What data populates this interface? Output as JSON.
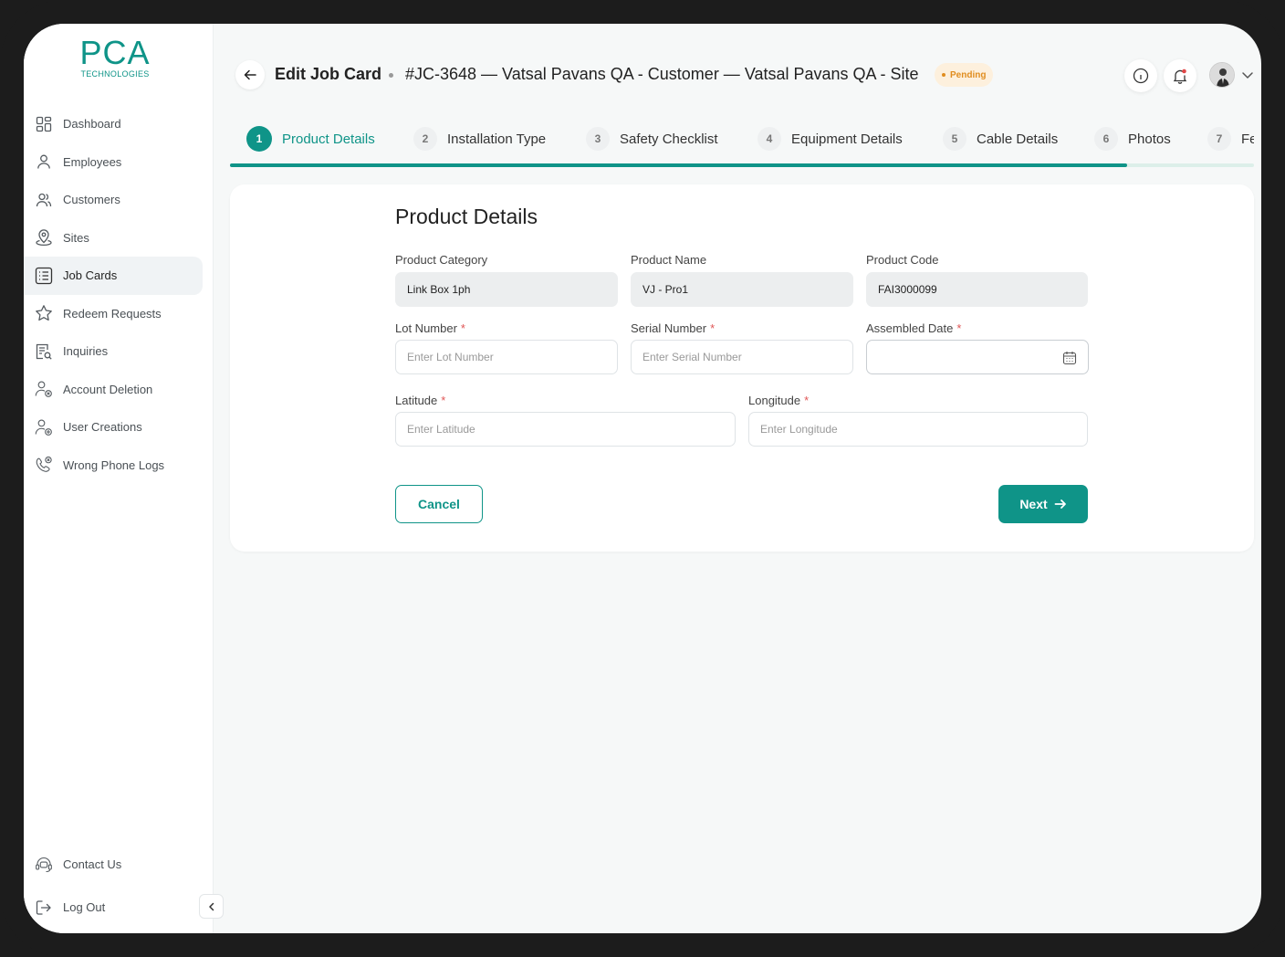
{
  "logo": {
    "main": "PCA",
    "sub": "TECHNOLOGIES"
  },
  "sidebar": {
    "items": [
      {
        "label": "Dashboard",
        "icon": "dashboard-grid-icon",
        "active": false
      },
      {
        "label": "Employees",
        "icon": "user-icon",
        "active": false
      },
      {
        "label": "Customers",
        "icon": "users-icon",
        "active": false
      },
      {
        "label": "Sites",
        "icon": "location-pin-icon",
        "active": false
      },
      {
        "label": "Job Cards",
        "icon": "list-icon",
        "active": true
      },
      {
        "label": "Redeem Requests",
        "icon": "star-icon",
        "active": false
      },
      {
        "label": "Inquiries",
        "icon": "document-search-icon",
        "active": false
      },
      {
        "label": "Account Deletion",
        "icon": "user-remove-icon",
        "active": false
      },
      {
        "label": "User Creations",
        "icon": "user-add-icon",
        "active": false
      },
      {
        "label": "Wrong Phone Logs",
        "icon": "phone-x-icon",
        "active": false
      }
    ],
    "bottom": [
      {
        "label": "Contact Us",
        "icon": "headset-icon"
      },
      {
        "label": "Log Out",
        "icon": "logout-icon"
      }
    ]
  },
  "header": {
    "title": "Edit Job Card",
    "subtitle": "#JC-3648 — Vatsal Pavans QA - Customer — Vatsal Pavans QA - Site",
    "status": "Pending",
    "status_color": "#e08d1f"
  },
  "steps": [
    {
      "num": "1",
      "label": "Product Details",
      "active": true
    },
    {
      "num": "2",
      "label": "Installation Type",
      "active": false
    },
    {
      "num": "3",
      "label": "Safety Checklist",
      "active": false
    },
    {
      "num": "4",
      "label": "Equipment Details",
      "active": false
    },
    {
      "num": "5",
      "label": "Cable Details",
      "active": false
    },
    {
      "num": "6",
      "label": "Photos",
      "active": false
    },
    {
      "num": "7",
      "label": "Fe",
      "active": false
    }
  ],
  "progress": 0.876,
  "form": {
    "title": "Product Details",
    "product_category": {
      "label": "Product Category",
      "value": "Link Box 1ph"
    },
    "product_name": {
      "label": "Product Name",
      "value": "VJ - Pro1"
    },
    "product_code": {
      "label": "Product Code",
      "value": "FAI3000099"
    },
    "lot_number": {
      "label": "Lot Number",
      "placeholder": "Enter Lot Number"
    },
    "serial_number": {
      "label": "Serial Number",
      "placeholder": "Enter Serial Number"
    },
    "assembled_date": {
      "label": "Assembled Date",
      "value": ""
    },
    "latitude": {
      "label": "Latitude",
      "placeholder": "Enter Latitude"
    },
    "longitude": {
      "label": "Longitude",
      "placeholder": "Enter Longitude"
    },
    "required_mark": "*",
    "cancel_label": "Cancel",
    "next_label": "Next"
  },
  "colors": {
    "accent": "#0f9488",
    "required": "#e05656"
  }
}
